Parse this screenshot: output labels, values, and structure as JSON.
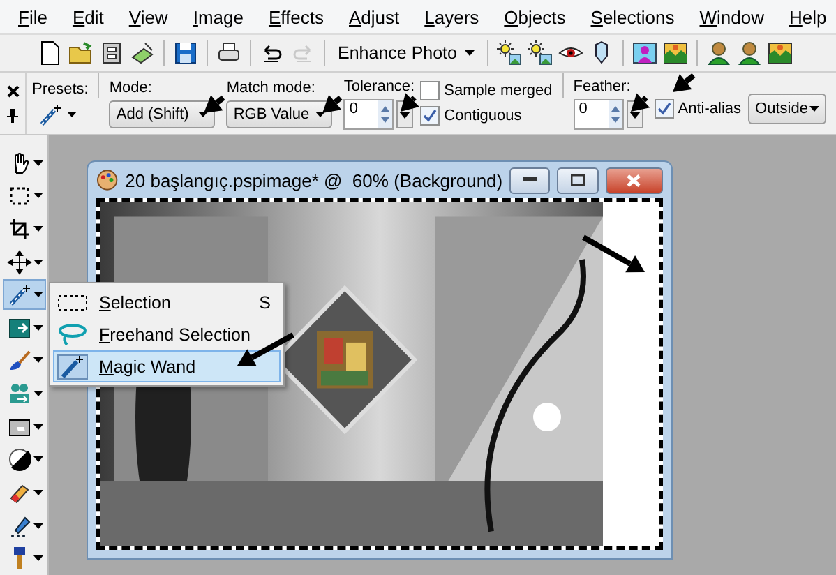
{
  "menu": [
    "File",
    "Edit",
    "View",
    "Image",
    "Effects",
    "Adjust",
    "Layers",
    "Objects",
    "Selections",
    "Window",
    "Help"
  ],
  "toolbar": {
    "left_icons": [
      {
        "kind": "new",
        "disabled": false
      },
      {
        "kind": "open",
        "disabled": false
      },
      {
        "kind": "browse",
        "disabled": false
      },
      {
        "kind": "scan",
        "disabled": false
      },
      {
        "kind": "save",
        "disabled": false
      },
      {
        "kind": "print",
        "disabled": false
      },
      {
        "kind": "undo",
        "disabled": false
      },
      {
        "kind": "redo",
        "disabled": true
      }
    ],
    "enhance_button": "Enhance Photo",
    "right_icons": [
      {
        "kind": "sun-photo"
      },
      {
        "kind": "sun-photo"
      },
      {
        "kind": "eye"
      },
      {
        "kind": "shield"
      },
      {
        "kind": "person-frame"
      },
      {
        "kind": "landscape"
      },
      {
        "kind": "person"
      },
      {
        "kind": "person"
      },
      {
        "kind": "landscape"
      }
    ]
  },
  "options": {
    "presets_label": "Presets:",
    "mode": {
      "label": "Mode:",
      "value": "Add (Shift)"
    },
    "match_mode": {
      "label": "Match mode:",
      "value": "RGB Value"
    },
    "tolerance": {
      "label": "Tolerance:",
      "value": "0"
    },
    "checks": [
      {
        "label": "Sample merged",
        "checked": false
      },
      {
        "label": "Contiguous",
        "checked": true
      }
    ],
    "feather": {
      "label": "Feather:",
      "value": "0"
    },
    "anti_alias": {
      "label": "Anti-alias",
      "checked": true
    },
    "outside": "Outside"
  },
  "tools": [
    {
      "kind": "hand",
      "selected": false
    },
    {
      "kind": "marquee",
      "selected": false
    },
    {
      "kind": "crop",
      "selected": false
    },
    {
      "kind": "move",
      "selected": false
    },
    {
      "kind": "wand",
      "selected": true
    },
    {
      "kind": "replacer",
      "selected": false
    },
    {
      "kind": "brush",
      "selected": false
    },
    {
      "kind": "clone",
      "selected": false
    },
    {
      "kind": "frame",
      "selected": false
    },
    {
      "kind": "dodge",
      "selected": false
    },
    {
      "kind": "eraser",
      "selected": false
    },
    {
      "kind": "fill",
      "selected": false
    },
    {
      "kind": "art",
      "selected": false
    }
  ],
  "flyout": [
    {
      "kind": "selection",
      "label": "Selection",
      "shortcut": "S",
      "selected": false
    },
    {
      "kind": "freehand",
      "label": "Freehand Selection",
      "selected": false
    },
    {
      "kind": "wand",
      "label": "Magic Wand",
      "selected": true
    }
  ],
  "document": {
    "title": "20 başlangıç.pspimage* @  60% (Background)"
  }
}
